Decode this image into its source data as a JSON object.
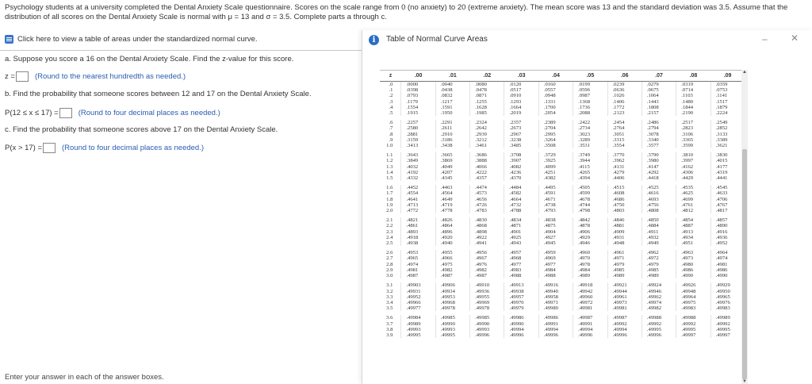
{
  "problem_text": "Psychology students at a university completed the Dental Anxiety Scale questionnaire. Scores on the scale range from 0 (no anxiety) to 20 (extreme anxiety). The mean score was 13 and the standard deviation was 3.5. Assume that the distribution of all scores on the Dental Anxiety Scale is normal with μ = 13 and σ = 3.5. Complete parts a through c.",
  "click_link": "Click here to view a table of areas under the standardized normal curve.",
  "part_a": {
    "question": "a. Suppose you score a 16 on the Dental Anxiety Scale. Find the z-value for this score.",
    "prefix": "z =",
    "hint": "(Round to the nearest hundredth as needed.)"
  },
  "part_b": {
    "question": "b. Find the probability that someone scores between 12 and 17 on the Dental Anxiety Scale.",
    "prefix": "P(12 ≤ x ≤ 17) =",
    "hint": "(Round to four decimal places as needed.)"
  },
  "part_c": {
    "question": "c. Find the probability that someone scores above 17 on the Dental Anxiety Scale.",
    "prefix": "P(x > 17) =",
    "hint": "(Round to four decimal places as needed.)"
  },
  "footer": "Enter your answer in each of the answer boxes.",
  "popup": {
    "title": "Table of Normal Curve Areas",
    "minimize": "–",
    "close": "✕"
  },
  "table": {
    "headers": [
      "z",
      ".00",
      ".01",
      ".02",
      ".03",
      ".04",
      ".05",
      ".06",
      ".07",
      ".08",
      ".09"
    ],
    "groups": [
      [
        [
          ".0",
          ".0000",
          ".0040",
          ".0080",
          ".0120",
          ".0160",
          ".0199",
          ".0239",
          ".0279",
          ".0319",
          ".0359"
        ],
        [
          ".1",
          ".0398",
          ".0438",
          ".0478",
          ".0517",
          ".0557",
          ".0596",
          ".0636",
          ".0675",
          ".0714",
          ".0753"
        ],
        [
          ".2",
          ".0793",
          ".0832",
          ".0871",
          ".0910",
          ".0948",
          ".0987",
          ".1026",
          ".1064",
          ".1103",
          ".1141"
        ],
        [
          ".3",
          ".1179",
          ".1217",
          ".1255",
          ".1293",
          ".1331",
          ".1368",
          ".1406",
          ".1443",
          ".1480",
          ".1517"
        ],
        [
          ".4",
          ".1554",
          ".1591",
          ".1628",
          ".1664",
          ".1700",
          ".1736",
          ".1772",
          ".1808",
          ".1844",
          ".1879"
        ],
        [
          ".5",
          ".1915",
          ".1950",
          ".1985",
          ".2019",
          ".2054",
          ".2088",
          ".2123",
          ".2157",
          ".2190",
          ".2224"
        ]
      ],
      [
        [
          ".6",
          ".2257",
          ".2291",
          ".2324",
          ".2357",
          ".2389",
          ".2422",
          ".2454",
          ".2486",
          ".2517",
          ".2549"
        ],
        [
          ".7",
          ".2580",
          ".2611",
          ".2642",
          ".2673",
          ".2704",
          ".2734",
          ".2764",
          ".2794",
          ".2823",
          ".2852"
        ],
        [
          ".8",
          ".2881",
          ".2910",
          ".2939",
          ".2967",
          ".2995",
          ".3023",
          ".3051",
          ".3078",
          ".3106",
          ".3133"
        ],
        [
          ".9",
          ".3159",
          ".3186",
          ".3212",
          ".3238",
          ".3264",
          ".3289",
          ".3315",
          ".3340",
          ".3365",
          ".3389"
        ],
        [
          "1.0",
          ".3413",
          ".3438",
          ".3461",
          ".3485",
          ".3508",
          ".3531",
          ".3554",
          ".3577",
          ".3599",
          ".3621"
        ]
      ],
      [
        [
          "1.1",
          ".3643",
          ".3665",
          ".3686",
          ".3708",
          ".3729",
          ".3749",
          ".3770",
          ".3790",
          ".3810",
          ".3830"
        ],
        [
          "1.2",
          ".3849",
          ".3869",
          ".3888",
          ".3907",
          ".3925",
          ".3944",
          ".3962",
          ".3980",
          ".3997",
          ".4015"
        ],
        [
          "1.3",
          ".4032",
          ".4049",
          ".4066",
          ".4082",
          ".4099",
          ".4115",
          ".4131",
          ".4147",
          ".4162",
          ".4177"
        ],
        [
          "1.4",
          ".4192",
          ".4207",
          ".4222",
          ".4236",
          ".4251",
          ".4265",
          ".4279",
          ".4292",
          ".4306",
          ".4319"
        ],
        [
          "1.5",
          ".4332",
          ".4345",
          ".4357",
          ".4370",
          ".4382",
          ".4394",
          ".4406",
          ".4418",
          ".4429",
          ".4441"
        ]
      ],
      [
        [
          "1.6",
          ".4452",
          ".4463",
          ".4474",
          ".4484",
          ".4495",
          ".4505",
          ".4515",
          ".4525",
          ".4535",
          ".4545"
        ],
        [
          "1.7",
          ".4554",
          ".4564",
          ".4573",
          ".4582",
          ".4591",
          ".4599",
          ".4608",
          ".4616",
          ".4625",
          ".4633"
        ],
        [
          "1.8",
          ".4641",
          ".4649",
          ".4656",
          ".4664",
          ".4671",
          ".4678",
          ".4686",
          ".4693",
          ".4699",
          ".4706"
        ],
        [
          "1.9",
          ".4713",
          ".4719",
          ".4726",
          ".4732",
          ".4738",
          ".4744",
          ".4750",
          ".4756",
          ".4761",
          ".4767"
        ],
        [
          "2.0",
          ".4772",
          ".4778",
          ".4783",
          ".4788",
          ".4793",
          ".4798",
          ".4803",
          ".4808",
          ".4812",
          ".4817"
        ]
      ],
      [
        [
          "2.1",
          ".4821",
          ".4826",
          ".4830",
          ".4834",
          ".4838",
          ".4842",
          ".4846",
          ".4850",
          ".4854",
          ".4857"
        ],
        [
          "2.2",
          ".4861",
          ".4864",
          ".4868",
          ".4871",
          ".4875",
          ".4878",
          ".4881",
          ".4884",
          ".4887",
          ".4890"
        ],
        [
          "2.3",
          ".4893",
          ".4896",
          ".4898",
          ".4901",
          ".4904",
          ".4906",
          ".4909",
          ".4911",
          ".4913",
          ".4916"
        ],
        [
          "2.4",
          ".4918",
          ".4920",
          ".4922",
          ".4925",
          ".4927",
          ".4929",
          ".4931",
          ".4932",
          ".4934",
          ".4936"
        ],
        [
          "2.5",
          ".4938",
          ".4940",
          ".4941",
          ".4943",
          ".4945",
          ".4946",
          ".4948",
          ".4949",
          ".4951",
          ".4952"
        ]
      ],
      [
        [
          "2.6",
          ".4953",
          ".4955",
          ".4956",
          ".4957",
          ".4959",
          ".4960",
          ".4961",
          ".4962",
          ".4963",
          ".4964"
        ],
        [
          "2.7",
          ".4965",
          ".4966",
          ".4967",
          ".4968",
          ".4969",
          ".4970",
          ".4971",
          ".4972",
          ".4973",
          ".4974"
        ],
        [
          "2.8",
          ".4974",
          ".4975",
          ".4976",
          ".4977",
          ".4977",
          ".4978",
          ".4979",
          ".4979",
          ".4980",
          ".4981"
        ],
        [
          "2.9",
          ".4981",
          ".4982",
          ".4982",
          ".4983",
          ".4984",
          ".4984",
          ".4985",
          ".4985",
          ".4986",
          ".4986"
        ],
        [
          "3.0",
          ".4987",
          ".4987",
          ".4987",
          ".4988",
          ".4988",
          ".4989",
          ".4989",
          ".4989",
          ".4990",
          ".4990"
        ]
      ],
      [
        [
          "3.1",
          ".49903",
          ".49906",
          ".49910",
          ".49913",
          ".49916",
          ".49918",
          ".49921",
          ".49924",
          ".49926",
          ".49929"
        ],
        [
          "3.2",
          ".49931",
          ".49934",
          ".49936",
          ".49938",
          ".49940",
          ".49942",
          ".49944",
          ".49946",
          ".49948",
          ".49950"
        ],
        [
          "3.3",
          ".49952",
          ".49953",
          ".49955",
          ".49957",
          ".49958",
          ".49960",
          ".49961",
          ".49962",
          ".49964",
          ".49965"
        ],
        [
          "3.4",
          ".49966",
          ".49968",
          ".49969",
          ".49970",
          ".49971",
          ".49972",
          ".49973",
          ".49974",
          ".49975",
          ".49976"
        ],
        [
          "3.5",
          ".49977",
          ".49978",
          ".49978",
          ".49979",
          ".49980",
          ".49981",
          ".49981",
          ".49982",
          ".49983",
          ".49983"
        ]
      ],
      [
        [
          "3.6",
          ".49984",
          ".49985",
          ".49985",
          ".49986",
          ".49986",
          ".49987",
          ".49987",
          ".49988",
          ".49988",
          ".49989"
        ],
        [
          "3.7",
          ".49989",
          ".49990",
          ".49990",
          ".49990",
          ".49991",
          ".49991",
          ".49992",
          ".49992",
          ".49992",
          ".49992"
        ],
        [
          "3.8",
          ".49993",
          ".49993",
          ".49993",
          ".49994",
          ".49994",
          ".49994",
          ".49994",
          ".49995",
          ".49995",
          ".49995"
        ],
        [
          "3.9",
          ".49995",
          ".49995",
          ".49996",
          ".49996",
          ".49996",
          ".49996",
          ".49996",
          ".49996",
          ".49997",
          ".49997"
        ]
      ]
    ]
  }
}
